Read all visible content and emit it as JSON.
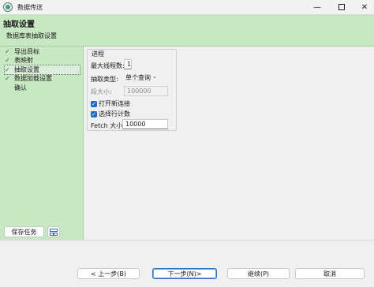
{
  "window": {
    "title": "数据传送",
    "controls": {
      "minimize": "—",
      "close": "✕"
    }
  },
  "header": {
    "title": "抽取设置",
    "subtitle": "数据库表抽取设置"
  },
  "steps": [
    {
      "label": "导出目标",
      "done": true,
      "check": "✓"
    },
    {
      "label": "表映射",
      "done": true,
      "check": "✓"
    },
    {
      "label": "抽取设置",
      "done": true,
      "check": "✓",
      "active": true
    },
    {
      "label": "数据加载设置",
      "done": true,
      "check": "✓"
    },
    {
      "label": "确认",
      "done": false,
      "check": ""
    }
  ],
  "sidebar": {
    "save_task_label": "保存任务",
    "task_icon": "tasks-icon"
  },
  "form": {
    "group_label": "进程",
    "max_threads_label": "最大线程数:",
    "max_threads_value": "1",
    "extract_type_label": "抽取类型:",
    "extract_type_value": "单个查询",
    "extract_type_arrow": "⌄",
    "segment_size_label": "段大小:",
    "segment_size_value": "100000",
    "open_new_connection_label": "打开新连接",
    "open_new_connection_checked": true,
    "select_row_count_label": "选择行计数",
    "select_row_count_checked": true,
    "check_mark": "✓",
    "fetch_size_label": "Fetch 大小:",
    "fetch_size_value": "10000"
  },
  "footer": {
    "prev_label": "< 上一步(B)",
    "next_label": "下一步(N)>",
    "continue_label": "继续(P)",
    "cancel_label": "取消"
  },
  "colors": {
    "accent_green": "#c8e8c3",
    "checkbox_blue": "#1e6cc8",
    "primary_border": "#2c6fc2"
  }
}
